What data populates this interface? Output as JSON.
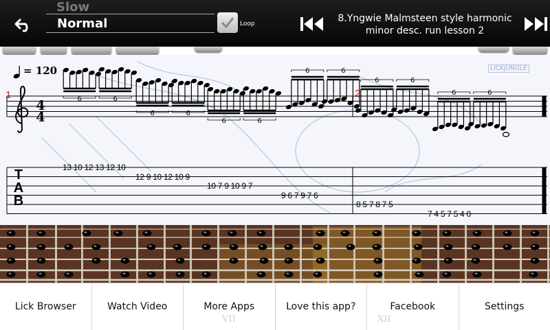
{
  "header": {
    "speed_previous": "Slow",
    "speed_current": "Normal",
    "loop_label": "Loop",
    "lesson_title": "8.Yngwie Malmsteen style harmonic minor desc. run lesson 2"
  },
  "icons": {
    "back": "back-arrow-icon",
    "loop_checkbox": "checkmark-icon",
    "previous": "skip-previous-icon",
    "next": "skip-next-icon"
  },
  "score": {
    "tempo": "= 120",
    "watermark": "LICKJUNGLE",
    "measure_numbers": [
      "1",
      "2"
    ],
    "tuplet_label": "6",
    "clef": "G-clef",
    "time_signature": {
      "top": "4",
      "bottom": "4"
    },
    "tab_clef": [
      "T",
      "A",
      "B"
    ],
    "tab_groups": [
      "13 10 12 13 12 10",
      "12 9 10 12 10 9",
      "10 7 9 10 9 7",
      "9 6 7 9 7 6",
      "8 5 7 8 7 5",
      "7 4 5 7 5 4 0"
    ]
  },
  "fretboard": {
    "fret_markers": [
      "VII",
      "XII"
    ],
    "colors": {
      "wood": "#5a3422",
      "highlight": "#c99a2e",
      "dot": "#000000"
    }
  },
  "menu": {
    "items": [
      "Lick Browser",
      "Watch Video",
      "More Apps",
      "Love this app?",
      "Facebook",
      "Settings"
    ]
  }
}
